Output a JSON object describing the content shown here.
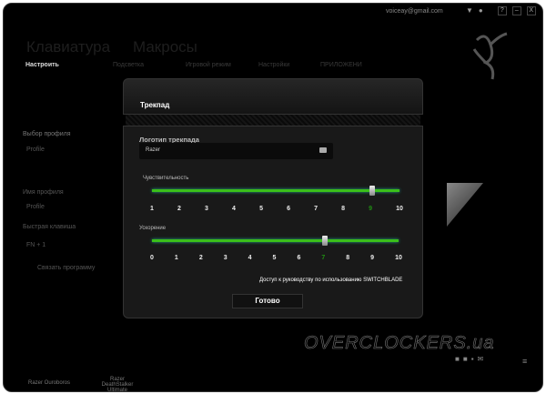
{
  "header": {
    "email": "voiceay@gmail.com",
    "help": "?",
    "minimize": "–",
    "close": "X"
  },
  "main_tabs": [
    "Клавиатура",
    "Макросы"
  ],
  "sub_tabs": [
    "Настроить",
    "Подсветка",
    "Игровой режим",
    "Настройки",
    "ПРИЛОЖЕНИ"
  ],
  "sidebar": {
    "profile_label": "Выбор профиля",
    "profile_value": "Profile",
    "name_label": "Имя профиля",
    "name_value": "Profile",
    "hotkey_label": "Быстрая клавиша",
    "hotkey_value": "FN + 1",
    "link_program": "Связать программу"
  },
  "devices": [
    "Razer Ouroboros",
    "Razer DeathStalker Ultimate"
  ],
  "dialog": {
    "title": "Трекпад",
    "logo_label": "Логотип трекпада",
    "logo_value": "Razer",
    "sensitivity": {
      "label": "Чувствительность",
      "ticks": [
        "1",
        "2",
        "3",
        "4",
        "5",
        "6",
        "7",
        "8",
        "9",
        "10"
      ],
      "value": 9,
      "min": 1,
      "max": 10
    },
    "acceleration": {
      "label": "Ускорение",
      "ticks": [
        "0",
        "1",
        "2",
        "3",
        "4",
        "5",
        "6",
        "7",
        "8",
        "9",
        "10"
      ],
      "value": 7,
      "min": 0,
      "max": 10
    },
    "guide_link": "Доступ к руководству по использованию SWITCHBLADE",
    "done": "Готово"
  },
  "watermark": "OVERCLOCKERS.ua",
  "colors": {
    "accent": "#3bbf1a",
    "active_tick": "#1f8f12"
  }
}
